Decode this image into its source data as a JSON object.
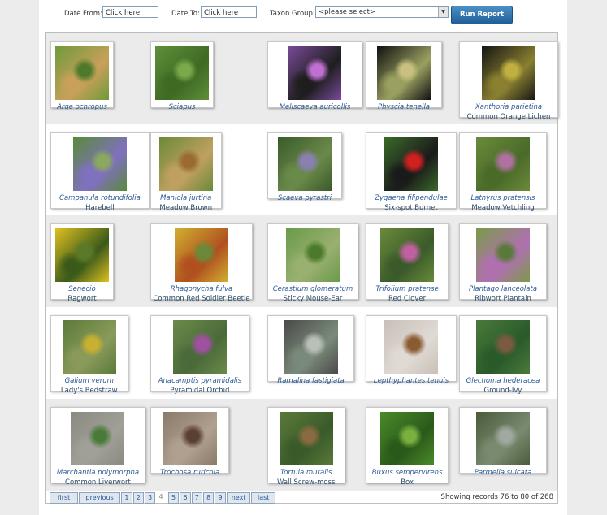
{
  "filters": {
    "date_from_label": "Date From:",
    "date_from_value": "Click here",
    "date_to_label": "Date To:",
    "date_to_value": "Click here",
    "taxon_label": "Taxon Group:",
    "taxon_value": "<please select>",
    "run_label": "Run Report"
  },
  "records": [
    [
      {
        "sci": "Arge ochropus",
        "common": "",
        "colors": [
          "#6f9a3a",
          "#4d7a2a",
          "#c8a05a"
        ],
        "icon": "sawfly-icon"
      },
      {
        "sci": "Sciapus",
        "common": "",
        "colors": [
          "#5f8f3a",
          "#7aa84a",
          "#3e6a22"
        ],
        "icon": "fly-icon"
      },
      {
        "sci": "Meliscaeva auricollis",
        "common": "",
        "colors": [
          "#7a4a9a",
          "#c070d0",
          "#1e1e1e"
        ],
        "icon": "hoverfly-icon"
      },
      {
        "sci": "Physcia tenella",
        "common": "",
        "colors": [
          "#111111",
          "#c8c080",
          "#9aa060"
        ],
        "icon": "lichen-icon"
      },
      {
        "sci": "Xanthoria parietina",
        "common": "Common Orange Lichen",
        "colors": [
          "#151515",
          "#c0b040",
          "#8a8030"
        ],
        "icon": "lichen-icon"
      }
    ],
    [
      {
        "sci": "Campanula rotundifolia",
        "common": "Harebell",
        "colors": [
          "#5a8a3a",
          "#8aa860",
          "#8070c0"
        ],
        "icon": "flower-icon"
      },
      {
        "sci": "Maniola jurtina",
        "common": "Meadow Brown",
        "colors": [
          "#6a8a3a",
          "#9a6a30",
          "#c0a060"
        ],
        "icon": "butterfly-icon"
      },
      {
        "sci": "Scaeva pyrastri",
        "common": "",
        "colors": [
          "#3a5a2a",
          "#8a80b0",
          "#6a8a4a"
        ],
        "icon": "hoverfly-icon"
      },
      {
        "sci": "Zygaena filipendulae",
        "common": "Six-spot Burnet",
        "colors": [
          "#3a6a2a",
          "#d02020",
          "#1a1a1a"
        ],
        "icon": "moth-icon"
      },
      {
        "sci": "Lathyrus pratensis",
        "common": "Meadow Vetchling",
        "colors": [
          "#6a8a3a",
          "#b070a0",
          "#4a6a2a"
        ],
        "icon": "flower-icon"
      }
    ],
    [
      {
        "sci": "Senecio",
        "common": "Ragwort",
        "colors": [
          "#e0c020",
          "#5a7a2a",
          "#3a5a1a"
        ],
        "icon": "flower-icon"
      },
      {
        "sci": "Rhagonycha fulva",
        "common": "Common Red Soldier Beetle",
        "colors": [
          "#d0b030",
          "#6a8a3a",
          "#b05020"
        ],
        "icon": "beetle-icon"
      },
      {
        "sci": "Cerastium glomeratum",
        "common": "Sticky Mouse-Ear",
        "colors": [
          "#6a9a4a",
          "#4a7a2a",
          "#9ab070"
        ],
        "icon": "flower-icon"
      },
      {
        "sci": "Trifolium pratense",
        "common": "Red Clover",
        "colors": [
          "#6a8a3a",
          "#c060a0",
          "#3a5a2a"
        ],
        "icon": "flower-icon"
      },
      {
        "sci": "Plantago lanceolata",
        "common": "Ribwort Plantain",
        "colors": [
          "#7a9a4a",
          "#5a7a3a",
          "#b070b0"
        ],
        "icon": "flower-icon"
      }
    ],
    [
      {
        "sci": "Galium verum",
        "common": "Lady's Bedstraw",
        "colors": [
          "#5a7a3a",
          "#c8b030",
          "#8a9a5a"
        ],
        "icon": "flower-icon"
      },
      {
        "sci": "Anacamptis pyramidalis",
        "common": "Pyramidal Orchid",
        "colors": [
          "#6a8a4a",
          "#a050a0",
          "#4a6a3a"
        ],
        "icon": "orchid-icon"
      },
      {
        "sci": "Ramalina fastigiata",
        "common": "",
        "colors": [
          "#4a4a4a",
          "#b8c0b8",
          "#7a8a7a"
        ],
        "icon": "lichen-icon"
      },
      {
        "sci": "Lepthyphantes tenuis",
        "common": "",
        "colors": [
          "#c8c0b8",
          "#8a5a30",
          "#e0dad4"
        ],
        "icon": "spider-icon"
      },
      {
        "sci": "Glechoma hederacea",
        "common": "Ground-Ivy",
        "colors": [
          "#4a7a3a",
          "#7a5a40",
          "#2a5a2a"
        ],
        "icon": "leaf-icon"
      }
    ],
    [
      {
        "sci": "Marchantia polymorpha",
        "common": "Common Liverwort",
        "colors": [
          "#8a8a80",
          "#4a7a3a",
          "#a0a098"
        ],
        "icon": "liverwort-icon"
      },
      {
        "sci": "Trochosa ruricola",
        "common": "",
        "colors": [
          "#8a7a6a",
          "#5a4030",
          "#b0a090"
        ],
        "icon": "spider-icon"
      },
      {
        "sci": "Tortula muralis",
        "common": "Wall Screw-moss",
        "colors": [
          "#5a7a3a",
          "#8a6a40",
          "#3a5a2a"
        ],
        "icon": "moss-icon"
      },
      {
        "sci": "Buxus sempervirens",
        "common": "Box",
        "colors": [
          "#4a8a2a",
          "#7ab040",
          "#2a5a1a"
        ],
        "icon": "leaf-icon"
      },
      {
        "sci": "Parmelia sulcata",
        "common": "",
        "colors": [
          "#4a5a3a",
          "#a0a8a0",
          "#7a8a70"
        ],
        "icon": "lichen-icon"
      }
    ]
  ],
  "pager": {
    "first": "first",
    "previous": "previous",
    "pages": [
      "1",
      "2",
      "3",
      "4",
      "5",
      "6",
      "7",
      "8",
      "9"
    ],
    "current": "4",
    "next": "next",
    "last": "last"
  },
  "status": "Showing records 76 to 80 of 268"
}
